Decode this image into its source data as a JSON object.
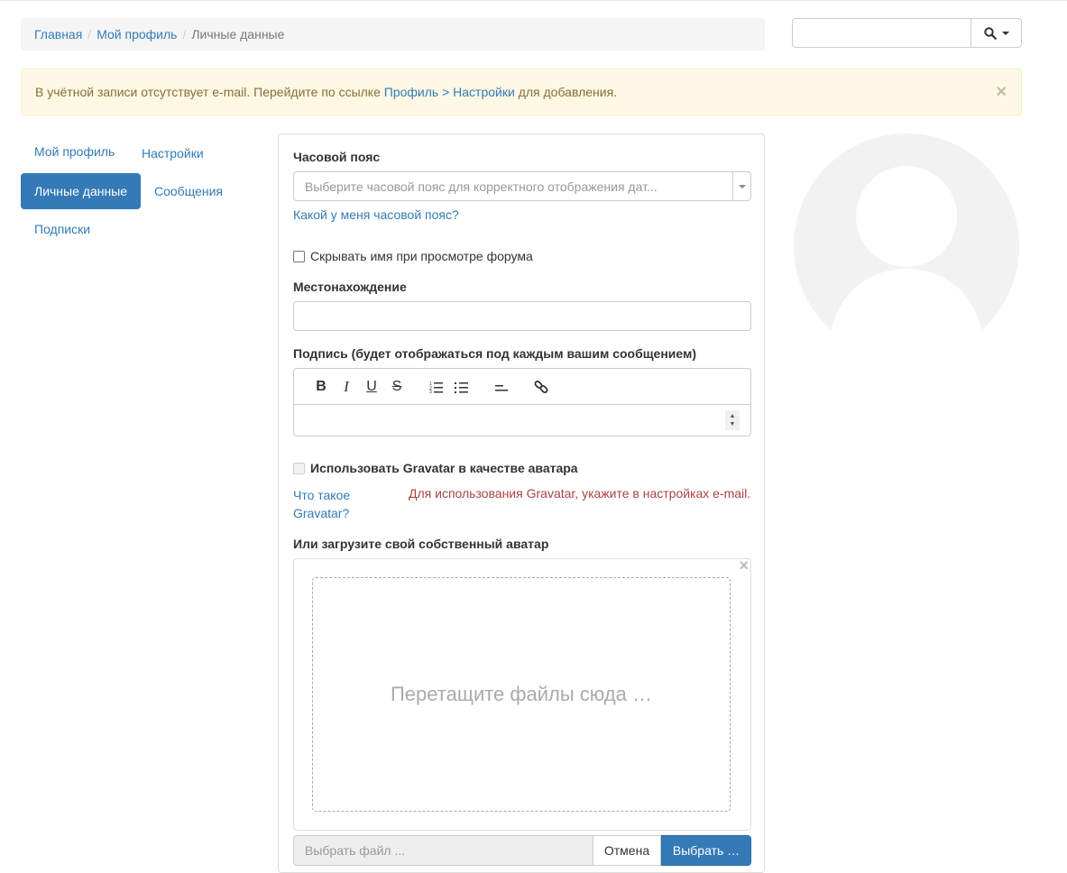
{
  "breadcrumb": {
    "home": "Главная",
    "profile": "Мой профиль",
    "current": "Личные данные",
    "separator": "/"
  },
  "search": {
    "placeholder": "",
    "icon": "search-icon"
  },
  "alert": {
    "text_before": "В учётной записи отсутствует e-mail. Перейдите по ссылке ",
    "link": "Профиль > Настройки",
    "text_after": " для добавления.",
    "close": "×"
  },
  "nav": {
    "my_profile": "Мой профиль",
    "settings": "Настройки",
    "personal": "Личные данные",
    "messages": "Сообщения",
    "subscriptions": "Подписки"
  },
  "form": {
    "timezone_label": "Часовой пояс",
    "timezone_placeholder": "Выберите часовой пояс для корректного отображения дат...",
    "timezone_link": "Какой у меня часовой пояс?",
    "hide_name_label": "Скрывать имя при просмотре форума",
    "location_label": "Местонахождение",
    "location_value": "",
    "signature_label": "Подпись (будет отображаться под каждым вашим сообщением)",
    "gravatar_label": "Использовать Gravatar в качестве аватара",
    "gravatar_link_line1": "Что такое",
    "gravatar_link_line2": "Gravatar?",
    "gravatar_error": "Для использования Gravatar, укажите в настройках e-mail.",
    "upload_label": "Или загрузите свой собственный аватар",
    "dropzone_text": "Перетащите файлы сюда …",
    "dropzone_close": "×",
    "file_caption": "Выбрать файл ...",
    "cancel_button": "Отмена",
    "browse_button": "Выбрать …"
  },
  "toolbar": {
    "bold": "B",
    "italic": "I",
    "underline": "U",
    "strike": "S"
  },
  "colors": {
    "accent": "#337ab7",
    "alert_bg": "#fcf8e3",
    "error": "#a94442"
  }
}
